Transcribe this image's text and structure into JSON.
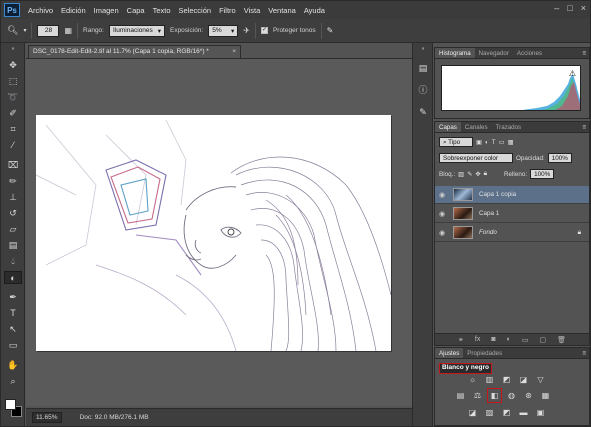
{
  "app": {
    "logo": "Ps"
  },
  "menu": [
    "Archivo",
    "Edición",
    "Imagen",
    "Capa",
    "Texto",
    "Selección",
    "Filtro",
    "Vista",
    "Ventana",
    "Ayuda"
  ],
  "window_controls": [
    "–",
    "□",
    "×"
  ],
  "options": {
    "brush_size": "28",
    "range_label": "Rango:",
    "range_value": "Iluminaciones",
    "exposure_label": "Exposición:",
    "exposure_value": "5%",
    "protect_label": "Proteger tonos",
    "protect_checked": "✓"
  },
  "document": {
    "tab_title": "DSC_0178-Edit-Edit-2.tif al 11.7% (Capa 1 copia, RGB/16*) *",
    "close": "×"
  },
  "status": {
    "zoom": "11.65%",
    "doc_info": "Doc: 92.0 MB/276.1 MB"
  },
  "histogram_panel": {
    "tabs": [
      "Histograma",
      "Navegador",
      "Acciones"
    ],
    "warning_icon": "⚠"
  },
  "layers_panel": {
    "tabs": [
      "Capas",
      "Canales",
      "Trazados"
    ],
    "filter": "Tipo",
    "blend_mode": "Sobreexponer color",
    "opacity_label": "Opacidad:",
    "opacity_value": "100%",
    "lock_label": "Bloq.:",
    "fill_label": "Relleno:",
    "fill_value": "100%",
    "layers": [
      {
        "name": "Capa 1 copia"
      },
      {
        "name": "Capa 1"
      },
      {
        "name": "Fondo"
      }
    ]
  },
  "adjustments_panel": {
    "tabs": [
      "Ajustes",
      "Propiedades"
    ],
    "title": "Blanco y negro"
  }
}
